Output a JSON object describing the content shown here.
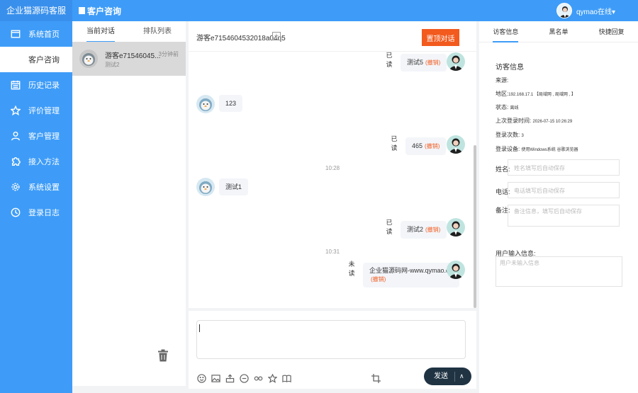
{
  "sidebar": {
    "brand": "企业猫源码客服",
    "items": [
      {
        "label": "系统首页",
        "icon": "window-icon"
      },
      {
        "label": "客户咨询",
        "icon": ""
      },
      {
        "label": "历史记录",
        "icon": "calendar-icon"
      },
      {
        "label": "评价管理",
        "icon": "star-icon"
      },
      {
        "label": "客户管理",
        "icon": "user-icon"
      },
      {
        "label": "接入方法",
        "icon": "puzzle-icon"
      },
      {
        "label": "系统设置",
        "icon": "gear-icon"
      },
      {
        "label": "登录日志",
        "icon": "clock-icon"
      }
    ],
    "active_index": 1
  },
  "header": {
    "title": "客户咨询",
    "user_name": "qymao在线▾"
  },
  "convlist": {
    "tabs": [
      "当前对话",
      "排队列表"
    ],
    "items": [
      {
        "name": "游客e71546045...",
        "time": "3分钟前",
        "last_msg": "测试2"
      }
    ]
  },
  "chat": {
    "visitor_id": "游客e7154604532018a04q5",
    "end_button": "置顶对话",
    "recall_label": "(撤销)",
    "messages": [
      {
        "from": "agent",
        "text": "测试5",
        "status": "已读"
      },
      {
        "from": "visitor",
        "text": "123"
      },
      {
        "from": "agent",
        "text": "465",
        "status": "已读"
      },
      {
        "from": "time",
        "text": "10:28"
      },
      {
        "from": "visitor",
        "text": "测试1"
      },
      {
        "from": "agent",
        "text": "测试2",
        "status": "已读"
      },
      {
        "from": "time",
        "text": "10:31"
      },
      {
        "from": "agent",
        "text": "企业猫源码网-www.qymao.cn",
        "status": "未读"
      }
    ]
  },
  "input": {
    "send_label": "发送",
    "send_arrow": "∧"
  },
  "rpanel": {
    "tabs": [
      "访客信息",
      "黑名单",
      "快捷回复"
    ],
    "section_title": "访客信息",
    "source_label": "来源:",
    "region_label": "地区:",
    "region_value": "192.168.17.1 【局域网 , 局域网 , 】",
    "status_label": "状态:",
    "status_value": "离线",
    "last_login_label": "上次登录时间:",
    "last_login_value": "2026-07-15 10:26:29",
    "login_count_label": "登录次数:",
    "login_count_value": "3",
    "device_label": "登录设备:",
    "device_value": "使用Windows系统 谷歌浏览器",
    "name_label": "姓名:",
    "name_placeholder": "姓名填写后自动保存",
    "phone_label": "电话:",
    "phone_placeholder": "电话填写后自动保存",
    "note_label": "备注:",
    "note_placeholder": "备注信息，填写后自动保存",
    "user_input_title": "用户输入信息:",
    "user_input_placeholder": "用户未输入信息"
  }
}
